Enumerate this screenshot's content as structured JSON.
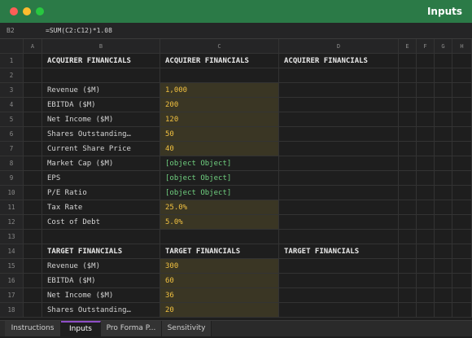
{
  "window": {
    "title": "Inputs"
  },
  "formula_bar": {
    "cell_ref": "B2",
    "formula": "=SUM(C2:C12)*1.08"
  },
  "columns": [
    "A",
    "B",
    "C",
    "D",
    "E",
    "F",
    "G",
    "H"
  ],
  "rows": [
    {
      "num": "1",
      "b": "ACQUIRER FINANCIALS",
      "c": "ACQUIRER FINANCIALS",
      "d": "ACQUIRER FINANCIALS"
    },
    {
      "num": "2",
      "b": "",
      "c": "",
      "d": ""
    },
    {
      "num": "3",
      "b": "Revenue ($M)",
      "c": "1,000",
      "d": ""
    },
    {
      "num": "4",
      "b": "EBITDA ($M)",
      "c": "200",
      "d": ""
    },
    {
      "num": "5",
      "b": "Net Income ($M)",
      "c": "120",
      "d": ""
    },
    {
      "num": "6",
      "b": "Shares Outstanding…",
      "c": "50",
      "d": ""
    },
    {
      "num": "7",
      "b": "Current Share Price",
      "c": "40",
      "d": ""
    },
    {
      "num": "8",
      "b": "Market Cap ($M)",
      "c": "[object Object]",
      "d": ""
    },
    {
      "num": "9",
      "b": "EPS",
      "c": "[object Object]",
      "d": ""
    },
    {
      "num": "10",
      "b": "P/E Ratio",
      "c": "[object Object]",
      "d": ""
    },
    {
      "num": "11",
      "b": "Tax Rate",
      "c": "25.0%",
      "d": ""
    },
    {
      "num": "12",
      "b": "Cost of Debt",
      "c": "5.0%",
      "d": ""
    },
    {
      "num": "13",
      "b": "",
      "c": "",
      "d": ""
    },
    {
      "num": "14",
      "b": "TARGET FINANCIALS",
      "c": "TARGET FINANCIALS",
      "d": "TARGET FINANCIALS"
    },
    {
      "num": "15",
      "b": "Revenue ($M)",
      "c": "300",
      "d": ""
    },
    {
      "num": "16",
      "b": "EBITDA ($M)",
      "c": "60",
      "d": ""
    },
    {
      "num": "17",
      "b": "Net Income ($M)",
      "c": "36",
      "d": ""
    },
    {
      "num": "18",
      "b": "Shares Outstanding…",
      "c": "20",
      "d": ""
    }
  ],
  "tabs": [
    {
      "label": "Instructions"
    },
    {
      "label": "Inputs"
    },
    {
      "label": "Pro Forma P..."
    },
    {
      "label": "Sensitivity"
    }
  ],
  "colors": {
    "titlebar": "#2b7a47",
    "input_fill": "#3a3624",
    "input_text": "#f0c040",
    "formula_text": "#6fcf7f",
    "active_tab": "#8e4ec6"
  }
}
